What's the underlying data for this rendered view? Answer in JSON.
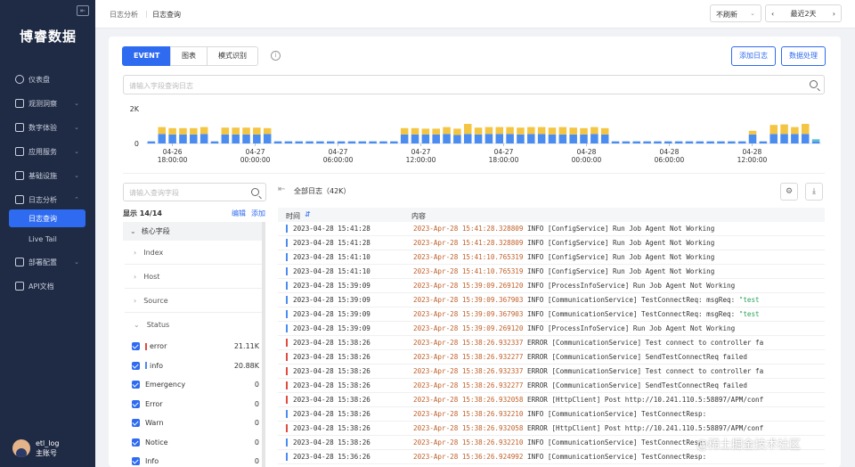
{
  "app": {
    "logo": "博睿数据"
  },
  "sidebar": {
    "items": [
      {
        "label": "仪表盘",
        "icon": "dashboard-icon"
      },
      {
        "label": "观测洞察",
        "icon": "observe-icon"
      },
      {
        "label": "数字体验",
        "icon": "experience-icon"
      },
      {
        "label": "应用服务",
        "icon": "app-icon"
      },
      {
        "label": "基础设施",
        "icon": "infra-icon"
      },
      {
        "label": "日志分析",
        "icon": "log-icon"
      },
      {
        "label": "部署配置",
        "icon": "deploy-icon"
      },
      {
        "label": "API文档",
        "icon": "api-doc-icon"
      }
    ],
    "sub": [
      {
        "label": "日志查询"
      },
      {
        "label": "Live Tail"
      }
    ]
  },
  "user": {
    "name": "etl_log",
    "role": "主账号"
  },
  "breadcrumb": [
    "日志分析",
    "日志查询"
  ],
  "topbar": {
    "refresh": "不刷新",
    "time_range": "最近2天"
  },
  "tabs": [
    "EVENT",
    "图表",
    "模式识别"
  ],
  "buttons": {
    "add_log": "添加日志",
    "data_process": "数据处理"
  },
  "search": {
    "placeholder": "请输入字段查询日志"
  },
  "chart_data": {
    "type": "bar",
    "ylabel_ticks": [
      "2K",
      "0"
    ],
    "ylim": [
      0,
      2000
    ],
    "x_ticks": [
      [
        "04-26",
        "18:00:00"
      ],
      [
        "04-27",
        "00:00:00"
      ],
      [
        "04-27",
        "06:00:00"
      ],
      [
        "04-27",
        "12:00:00"
      ],
      [
        "04-27",
        "18:00:00"
      ],
      [
        "04-28",
        "00:00:00"
      ],
      [
        "04-28",
        "06:00:00"
      ],
      [
        "04-28",
        "12:00:00"
      ]
    ],
    "series": [
      {
        "color": "#4a8cf0",
        "values": [
          200,
          900,
          850,
          850,
          850,
          900,
          200,
          850,
          850,
          850,
          850,
          900,
          200,
          200,
          200,
          200,
          200,
          200,
          200,
          200,
          200,
          200,
          200,
          200,
          850,
          850,
          850,
          850,
          900,
          800,
          900,
          850,
          900,
          900,
          900,
          850,
          900,
          900,
          850,
          850,
          850,
          850,
          900,
          850,
          200,
          200,
          200,
          200,
          200,
          200,
          200,
          200,
          200,
          200,
          200,
          200,
          200,
          850,
          200,
          900,
          900,
          900,
          900,
          200
        ]
      },
      {
        "color": "#f4c542",
        "values": [
          0,
          650,
          600,
          600,
          600,
          650,
          0,
          650,
          650,
          650,
          650,
          550,
          0,
          0,
          0,
          0,
          0,
          0,
          0,
          0,
          0,
          0,
          0,
          0,
          600,
          600,
          550,
          550,
          650,
          600,
          950,
          650,
          650,
          650,
          650,
          650,
          650,
          650,
          650,
          700,
          650,
          600,
          650,
          600,
          0,
          0,
          0,
          0,
          0,
          0,
          0,
          0,
          0,
          0,
          0,
          0,
          0,
          350,
          0,
          850,
          900,
          650,
          950,
          0
        ]
      },
      {
        "color": "#5bc2cf",
        "values": [
          0,
          0,
          0,
          0,
          0,
          0,
          0,
          0,
          0,
          0,
          0,
          0,
          0,
          0,
          0,
          0,
          0,
          0,
          0,
          0,
          0,
          0,
          0,
          0,
          0,
          0,
          0,
          0,
          0,
          0,
          0,
          0,
          0,
          0,
          0,
          0,
          0,
          0,
          0,
          0,
          0,
          0,
          0,
          0,
          0,
          0,
          0,
          0,
          0,
          0,
          0,
          0,
          0,
          0,
          0,
          0,
          0,
          0,
          0,
          0,
          0,
          0,
          0,
          200
        ]
      }
    ]
  },
  "fields": {
    "search_placeholder": "请输入查询字段",
    "display": "显示 14/14",
    "edit": "编辑",
    "add": "添加",
    "core": "核心字段",
    "items": [
      "Index",
      "Host",
      "Source",
      "Status"
    ],
    "status": [
      {
        "label": "error",
        "count": "21.11K",
        "color": "#e04a3f"
      },
      {
        "label": "info",
        "count": "20.88K",
        "color": "#4a8cf0"
      },
      {
        "label": "Emergency",
        "count": "0"
      },
      {
        "label": "Error",
        "count": "0"
      },
      {
        "label": "Warn",
        "count": "0"
      },
      {
        "label": "Notice",
        "count": "0"
      },
      {
        "label": "Info",
        "count": "0"
      }
    ]
  },
  "logs": {
    "title": "全部日志（42K）",
    "col_time": "时间",
    "col_content": "内容",
    "rows": [
      {
        "level": "info",
        "time": "2023-04-28 15:41:28",
        "ts": "2023-Apr-28 15:41:28.328809",
        "msg": " INFO [ConfigService] Run Job Agent Not Working"
      },
      {
        "level": "info",
        "time": "2023-04-28 15:41:28",
        "ts": "2023-Apr-28 15:41:28.328809",
        "msg": " INFO [ConfigService] Run Job Agent Not Working"
      },
      {
        "level": "info",
        "time": "2023-04-28 15:41:10",
        "ts": "2023-Apr-28 15:41:10.765319",
        "msg": " INFO [ConfigService] Run Job Agent Not Working"
      },
      {
        "level": "info",
        "time": "2023-04-28 15:41:10",
        "ts": "2023-Apr-28 15:41:10.765319",
        "msg": " INFO [ConfigService] Run Job Agent Not Working"
      },
      {
        "level": "info",
        "time": "2023-04-28 15:39:09",
        "ts": "2023-Apr-28 15:39:09.269120",
        "msg": " INFO [ProcessInfoService] Run Job Agent Not Working"
      },
      {
        "level": "info",
        "time": "2023-04-28 15:39:09",
        "ts": "2023-Apr-28 15:39:09.367903",
        "msg": " INFO [CommunicationService] TestConnectReq: msgReq: \"test ",
        "q": true
      },
      {
        "level": "info",
        "time": "2023-04-28 15:39:09",
        "ts": "2023-Apr-28 15:39:09.367903",
        "msg": " INFO [CommunicationService] TestConnectReq: msgReq: \"test ",
        "q": true
      },
      {
        "level": "info",
        "time": "2023-04-28 15:39:09",
        "ts": "2023-Apr-28 15:39:09.269120",
        "msg": " INFO [ProcessInfoService] Run Job Agent Not Working"
      },
      {
        "level": "error",
        "time": "2023-04-28 15:38:26",
        "ts": "2023-Apr-28 15:38:26.932337",
        "msg": " ERROR [CommunicationService] Test connect to controller fa"
      },
      {
        "level": "error",
        "time": "2023-04-28 15:38:26",
        "ts": "2023-Apr-28 15:38:26.932277",
        "msg": " ERROR [CommunicationService] SendTestConnectReq failed"
      },
      {
        "level": "error",
        "time": "2023-04-28 15:38:26",
        "ts": "2023-Apr-28 15:38:26.932337",
        "msg": " ERROR [CommunicationService] Test connect to controller fa"
      },
      {
        "level": "error",
        "time": "2023-04-28 15:38:26",
        "ts": "2023-Apr-28 15:38:26.932277",
        "msg": " ERROR [CommunicationService] SendTestConnectReq failed"
      },
      {
        "level": "error",
        "time": "2023-04-28 15:38:26",
        "ts": "2023-Apr-28 15:38:26.932058",
        "msg": " ERROR [HttpClient] Post http://10.241.110.5:58897/APM/conf"
      },
      {
        "level": "info",
        "time": "2023-04-28 15:38:26",
        "ts": "2023-Apr-28 15:38:26.932210",
        "msg": " INFO [CommunicationService] TestConnectResp:"
      },
      {
        "level": "error",
        "time": "2023-04-28 15:38:26",
        "ts": "2023-Apr-28 15:38:26.932058",
        "msg": " ERROR [HttpClient] Post http://10.241.110.5:58897/APM/conf"
      },
      {
        "level": "info",
        "time": "2023-04-28 15:38:26",
        "ts": "2023-Apr-28 15:38:26.932210",
        "msg": " INFO [CommunicationService] TestConnectResp:"
      },
      {
        "level": "info",
        "time": "2023-04-28 15:36:26",
        "ts": "2023-Apr-28 15:36:26.924992",
        "msg": " INFO [CommunicationService] TestConnectResp:"
      }
    ]
  },
  "watermark": "@稀土掘金技术社区"
}
